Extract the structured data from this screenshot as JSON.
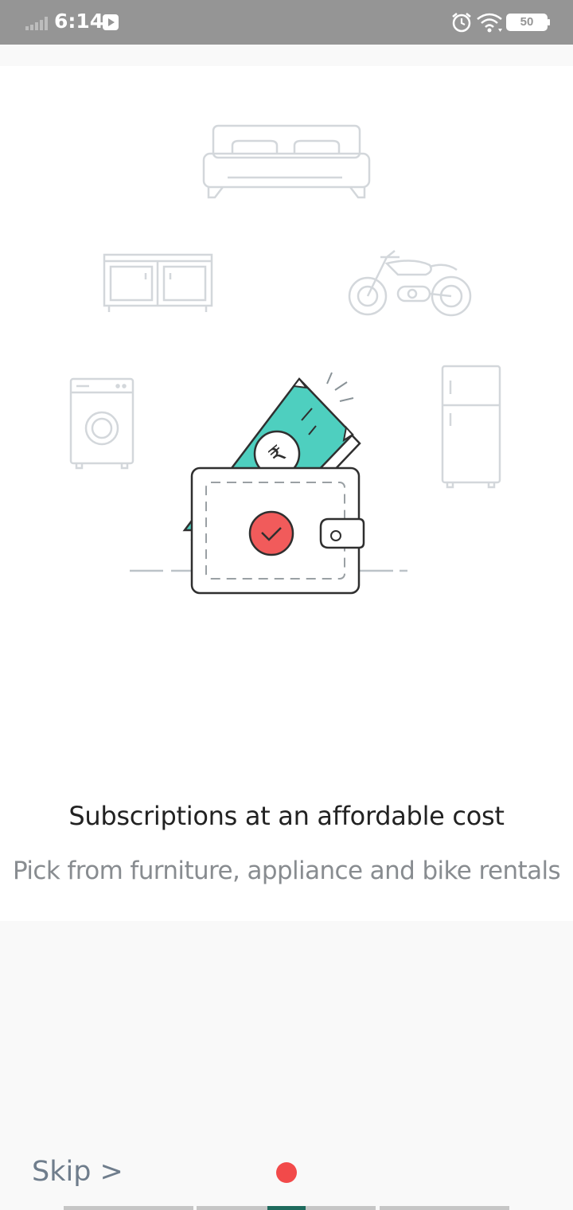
{
  "status_bar": {
    "time": "6:14",
    "battery": "50",
    "icons": [
      "signal-icon",
      "play-icon",
      "alarm-icon",
      "wifi-icon",
      "battery-icon"
    ]
  },
  "onboarding": {
    "title": "Subscriptions at an affordable cost",
    "subtitle": "Pick from furniture, appliance and bike rentals",
    "currency_symbol": "₹",
    "illustration_icons": [
      "bed-icon",
      "cabinet-icon",
      "motorbike-icon",
      "washing-machine-icon",
      "fridge-icon",
      "wallet-icon",
      "banknote-icon",
      "check-icon"
    ]
  },
  "footer": {
    "skip_label": "Skip >",
    "page_indicator_active": 2,
    "pages": 4
  },
  "colors": {
    "accent_red": "#f24a4a",
    "teal": "#4ecfbf",
    "progress_active": "#1f6b5e"
  }
}
